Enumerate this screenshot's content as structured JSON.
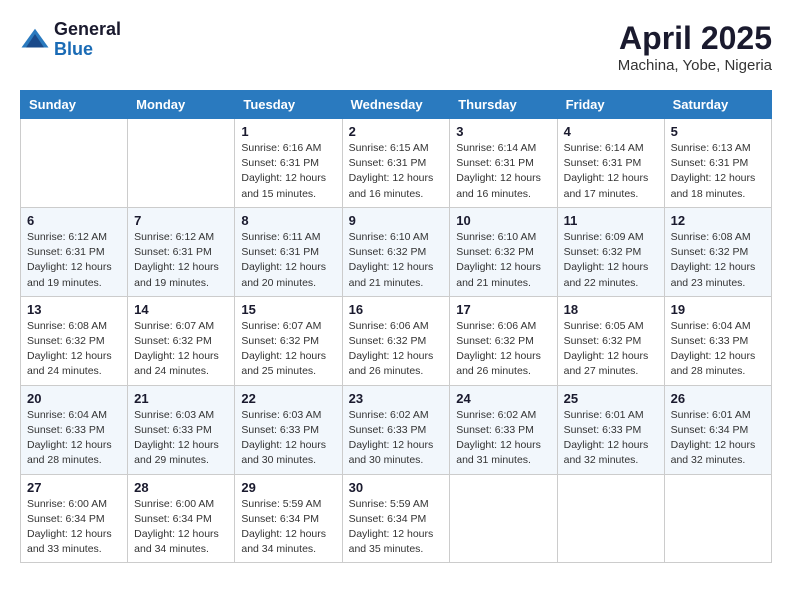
{
  "header": {
    "logo": {
      "general": "General",
      "blue": "Blue"
    },
    "title": "April 2025",
    "location": "Machina, Yobe, Nigeria"
  },
  "calendar": {
    "columns": [
      "Sunday",
      "Monday",
      "Tuesday",
      "Wednesday",
      "Thursday",
      "Friday",
      "Saturday"
    ],
    "weeks": [
      [
        null,
        null,
        {
          "day": 1,
          "sunrise": "6:16 AM",
          "sunset": "6:31 PM",
          "daylight": "12 hours and 15 minutes."
        },
        {
          "day": 2,
          "sunrise": "6:15 AM",
          "sunset": "6:31 PM",
          "daylight": "12 hours and 16 minutes."
        },
        {
          "day": 3,
          "sunrise": "6:14 AM",
          "sunset": "6:31 PM",
          "daylight": "12 hours and 16 minutes."
        },
        {
          "day": 4,
          "sunrise": "6:14 AM",
          "sunset": "6:31 PM",
          "daylight": "12 hours and 17 minutes."
        },
        {
          "day": 5,
          "sunrise": "6:13 AM",
          "sunset": "6:31 PM",
          "daylight": "12 hours and 18 minutes."
        }
      ],
      [
        {
          "day": 6,
          "sunrise": "6:12 AM",
          "sunset": "6:31 PM",
          "daylight": "12 hours and 19 minutes."
        },
        {
          "day": 7,
          "sunrise": "6:12 AM",
          "sunset": "6:31 PM",
          "daylight": "12 hours and 19 minutes."
        },
        {
          "day": 8,
          "sunrise": "6:11 AM",
          "sunset": "6:31 PM",
          "daylight": "12 hours and 20 minutes."
        },
        {
          "day": 9,
          "sunrise": "6:10 AM",
          "sunset": "6:32 PM",
          "daylight": "12 hours and 21 minutes."
        },
        {
          "day": 10,
          "sunrise": "6:10 AM",
          "sunset": "6:32 PM",
          "daylight": "12 hours and 21 minutes."
        },
        {
          "day": 11,
          "sunrise": "6:09 AM",
          "sunset": "6:32 PM",
          "daylight": "12 hours and 22 minutes."
        },
        {
          "day": 12,
          "sunrise": "6:08 AM",
          "sunset": "6:32 PM",
          "daylight": "12 hours and 23 minutes."
        }
      ],
      [
        {
          "day": 13,
          "sunrise": "6:08 AM",
          "sunset": "6:32 PM",
          "daylight": "12 hours and 24 minutes."
        },
        {
          "day": 14,
          "sunrise": "6:07 AM",
          "sunset": "6:32 PM",
          "daylight": "12 hours and 24 minutes."
        },
        {
          "day": 15,
          "sunrise": "6:07 AM",
          "sunset": "6:32 PM",
          "daylight": "12 hours and 25 minutes."
        },
        {
          "day": 16,
          "sunrise": "6:06 AM",
          "sunset": "6:32 PM",
          "daylight": "12 hours and 26 minutes."
        },
        {
          "day": 17,
          "sunrise": "6:06 AM",
          "sunset": "6:32 PM",
          "daylight": "12 hours and 26 minutes."
        },
        {
          "day": 18,
          "sunrise": "6:05 AM",
          "sunset": "6:32 PM",
          "daylight": "12 hours and 27 minutes."
        },
        {
          "day": 19,
          "sunrise": "6:04 AM",
          "sunset": "6:33 PM",
          "daylight": "12 hours and 28 minutes."
        }
      ],
      [
        {
          "day": 20,
          "sunrise": "6:04 AM",
          "sunset": "6:33 PM",
          "daylight": "12 hours and 28 minutes."
        },
        {
          "day": 21,
          "sunrise": "6:03 AM",
          "sunset": "6:33 PM",
          "daylight": "12 hours and 29 minutes."
        },
        {
          "day": 22,
          "sunrise": "6:03 AM",
          "sunset": "6:33 PM",
          "daylight": "12 hours and 30 minutes."
        },
        {
          "day": 23,
          "sunrise": "6:02 AM",
          "sunset": "6:33 PM",
          "daylight": "12 hours and 30 minutes."
        },
        {
          "day": 24,
          "sunrise": "6:02 AM",
          "sunset": "6:33 PM",
          "daylight": "12 hours and 31 minutes."
        },
        {
          "day": 25,
          "sunrise": "6:01 AM",
          "sunset": "6:33 PM",
          "daylight": "12 hours and 32 minutes."
        },
        {
          "day": 26,
          "sunrise": "6:01 AM",
          "sunset": "6:34 PM",
          "daylight": "12 hours and 32 minutes."
        }
      ],
      [
        {
          "day": 27,
          "sunrise": "6:00 AM",
          "sunset": "6:34 PM",
          "daylight": "12 hours and 33 minutes."
        },
        {
          "day": 28,
          "sunrise": "6:00 AM",
          "sunset": "6:34 PM",
          "daylight": "12 hours and 34 minutes."
        },
        {
          "day": 29,
          "sunrise": "5:59 AM",
          "sunset": "6:34 PM",
          "daylight": "12 hours and 34 minutes."
        },
        {
          "day": 30,
          "sunrise": "5:59 AM",
          "sunset": "6:34 PM",
          "daylight": "12 hours and 35 minutes."
        },
        null,
        null,
        null
      ]
    ]
  }
}
